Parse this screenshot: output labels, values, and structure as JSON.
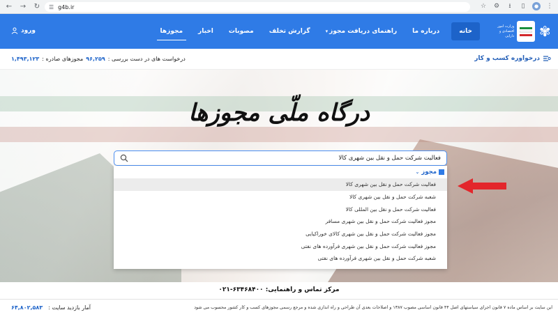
{
  "browser": {
    "url": "g4b.ir"
  },
  "header": {
    "logo_text": "وزارت امور اقتصادی و دارایی",
    "menu": [
      {
        "label": "خانه"
      },
      {
        "label": "درباره ما"
      },
      {
        "label": "راهنمای دریافت مجوز"
      },
      {
        "label": "گزارش تخلف"
      },
      {
        "label": "مصوبات"
      },
      {
        "label": "اخبار"
      },
      {
        "label": "مجوزها"
      }
    ],
    "login": "ورود"
  },
  "statsbar": {
    "dashboard_link": "درخواوره کسب و کار",
    "pending_label": "درخواست های در دست بررسی :",
    "pending_value": "۹۶,۲۵۹",
    "issued_label": "مجوزهای صادره :",
    "issued_value": "۱,۴۹۳,۱۲۳"
  },
  "hero": {
    "brand": "درگاه ملّی مجوزها"
  },
  "search": {
    "value": "فعالیت شرکت حمل و نقل بین شهری کالا",
    "placeholder": ""
  },
  "dropdown": {
    "category": "مجوز",
    "items": [
      "فعالیت شرکت حمل و نقل بین شهری کالا",
      "شعبه شرکت حمل و نقل بین شهری کالا",
      "فعالیت شرکت حمل و نقل بین المللی کالا",
      "مجوز فعالیت شرکت حمل و نقل بین شهری مسافر",
      "مجوز فعالیت شرکت حمل و نقل بین شهری کالای خوراکیایی",
      "مجوز فعالیت شرکت حمل و نقل بین شهری فرآورده های نفتی",
      "شعبه شرکت حمل و نقل بین شهری فرآورده های نفتی"
    ]
  },
  "contact": {
    "label": "مرکز تماس و راهنمایی:",
    "phone": "۰۲۱-۶۳۴۶۸۴۰۰"
  },
  "footer": {
    "legal": "این سایت بر اساس ماده ۷ قانون اجرای سیاستهای اصل ۴۴ قانون اساسی مصوب ۱۳۸۷ و اصلاحات بعدی آن طراحی و راه اندازی شده و مرجع رسمی مجوزهای کسب و کار کشور محسوب می شود",
    "visits_label": "آمار بازدید سایت :",
    "visits_value": "۶۴,۸۰۲,۵۸۳"
  },
  "colors": {
    "primary": "#2f7be6",
    "arrow": "#e3262b"
  }
}
